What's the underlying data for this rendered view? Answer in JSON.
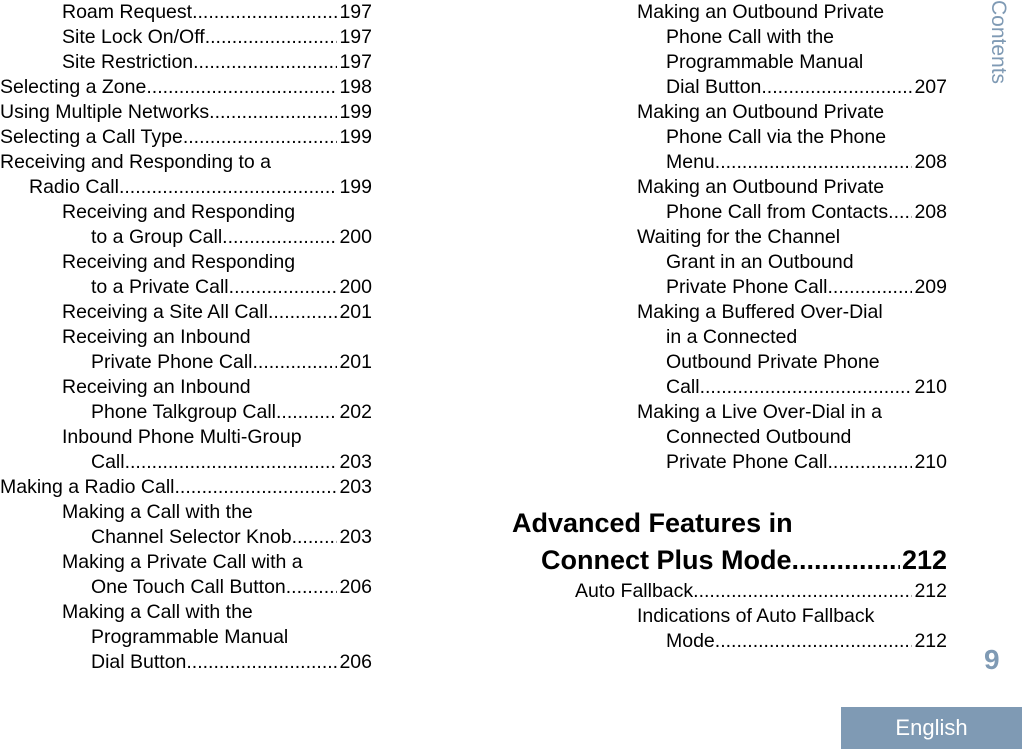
{
  "left_column": [
    {
      "level": "lvl2",
      "cont": "lvl2",
      "lines": [
        "Roam Request"
      ],
      "page": "197"
    },
    {
      "level": "lvl2",
      "cont": "lvl2",
      "lines": [
        "Site Lock On/Off"
      ],
      "page": "197"
    },
    {
      "level": "lvl2",
      "cont": "lvl2",
      "lines": [
        "Site Restriction"
      ],
      "page": "197"
    },
    {
      "level": "lvl0",
      "cont": "lvl0",
      "lines": [
        "Selecting a Zone"
      ],
      "page": "198"
    },
    {
      "level": "lvl0",
      "cont": "lvl0",
      "lines": [
        "Using Multiple Networks"
      ],
      "page": "199"
    },
    {
      "level": "lvl0",
      "cont": "lvl0",
      "lines": [
        "Selecting a Call Type"
      ],
      "page": "199"
    },
    {
      "level": "lvl0",
      "cont": "lvl1",
      "lines": [
        "Receiving and Responding to a",
        "Radio Call"
      ],
      "page": "199"
    },
    {
      "level": "lvl2",
      "cont": "lvl3",
      "lines": [
        "Receiving and Responding",
        "to a Group Call"
      ],
      "page": "200"
    },
    {
      "level": "lvl2",
      "cont": "lvl3",
      "lines": [
        "Receiving and Responding",
        "to a Private Call"
      ],
      "page": "200"
    },
    {
      "level": "lvl2",
      "cont": "lvl2",
      "lines": [
        "Receiving a Site All Call"
      ],
      "page": "201"
    },
    {
      "level": "lvl2",
      "cont": "lvl3",
      "lines": [
        "Receiving an Inbound",
        "Private Phone Call"
      ],
      "page": "201"
    },
    {
      "level": "lvl2",
      "cont": "lvl3",
      "lines": [
        "Receiving an Inbound",
        "Phone Talkgroup Call"
      ],
      "page": "202"
    },
    {
      "level": "lvl2",
      "cont": "lvl3",
      "lines": [
        "Inbound Phone Multi-Group",
        "Call"
      ],
      "page": "203"
    },
    {
      "level": "lvl0",
      "cont": "lvl0",
      "lines": [
        "Making a Radio Call"
      ],
      "page": "203"
    },
    {
      "level": "lvl2",
      "cont": "lvl3",
      "lines": [
        "Making a Call with the",
        "Channel Selector Knob"
      ],
      "page": "203"
    },
    {
      "level": "lvl2",
      "cont": "lvl3",
      "lines": [
        "Making a Private Call with a",
        "One Touch Call Button"
      ],
      "page": "206"
    },
    {
      "level": "lvl2",
      "cont": "lvl3",
      "lines": [
        "Making a Call with the",
        "Programmable Manual",
        "Dial Button"
      ],
      "page": "206"
    }
  ],
  "right_column": [
    {
      "level": "lvlR1",
      "cont": "lvlR2",
      "lines": [
        "Making an Outbound Private",
        "Phone Call with the",
        "Programmable Manual",
        "Dial Button"
      ],
      "page": "207"
    },
    {
      "level": "lvlR1",
      "cont": "lvlR2",
      "lines": [
        "Making an Outbound Private",
        "Phone Call via the Phone",
        "Menu"
      ],
      "page": "208"
    },
    {
      "level": "lvlR1",
      "cont": "lvlR2",
      "lines": [
        "Making an Outbound Private",
        "Phone Call from Contacts."
      ],
      "page": "208"
    },
    {
      "level": "lvlR1",
      "cont": "lvlR2",
      "lines": [
        "Waiting for the Channel",
        "Grant in an Outbound",
        "Private Phone Call"
      ],
      "page": "209"
    },
    {
      "level": "lvlR1",
      "cont": "lvlR2",
      "lines": [
        "Making a Buffered Over-Dial",
        "in a Connected",
        "Outbound Private Phone",
        "Call"
      ],
      "page": "210"
    },
    {
      "level": "lvlR1",
      "cont": "lvlR2",
      "lines": [
        "Making a Live Over-Dial in a",
        "Connected Outbound",
        "Private Phone Call"
      ],
      "page": "210"
    }
  ],
  "section_heading": {
    "lines": [
      "Advanced Features in",
      "Connect Plus Mode"
    ],
    "page": "212"
  },
  "section_entries": [
    {
      "level": "lvlS1",
      "cont": "lvlS1",
      "lines": [
        "Auto Fallback"
      ],
      "page": "212"
    },
    {
      "level": "lvlS2",
      "cont": "lvlS3",
      "lines": [
        "Indications of Auto Fallback",
        "Mode"
      ],
      "page": "212"
    }
  ],
  "sidebar": {
    "label": "Contents"
  },
  "footer": {
    "page_number": "9",
    "language": "English"
  },
  "colors": {
    "accent": "#7f9ab4",
    "text": "#000000"
  }
}
